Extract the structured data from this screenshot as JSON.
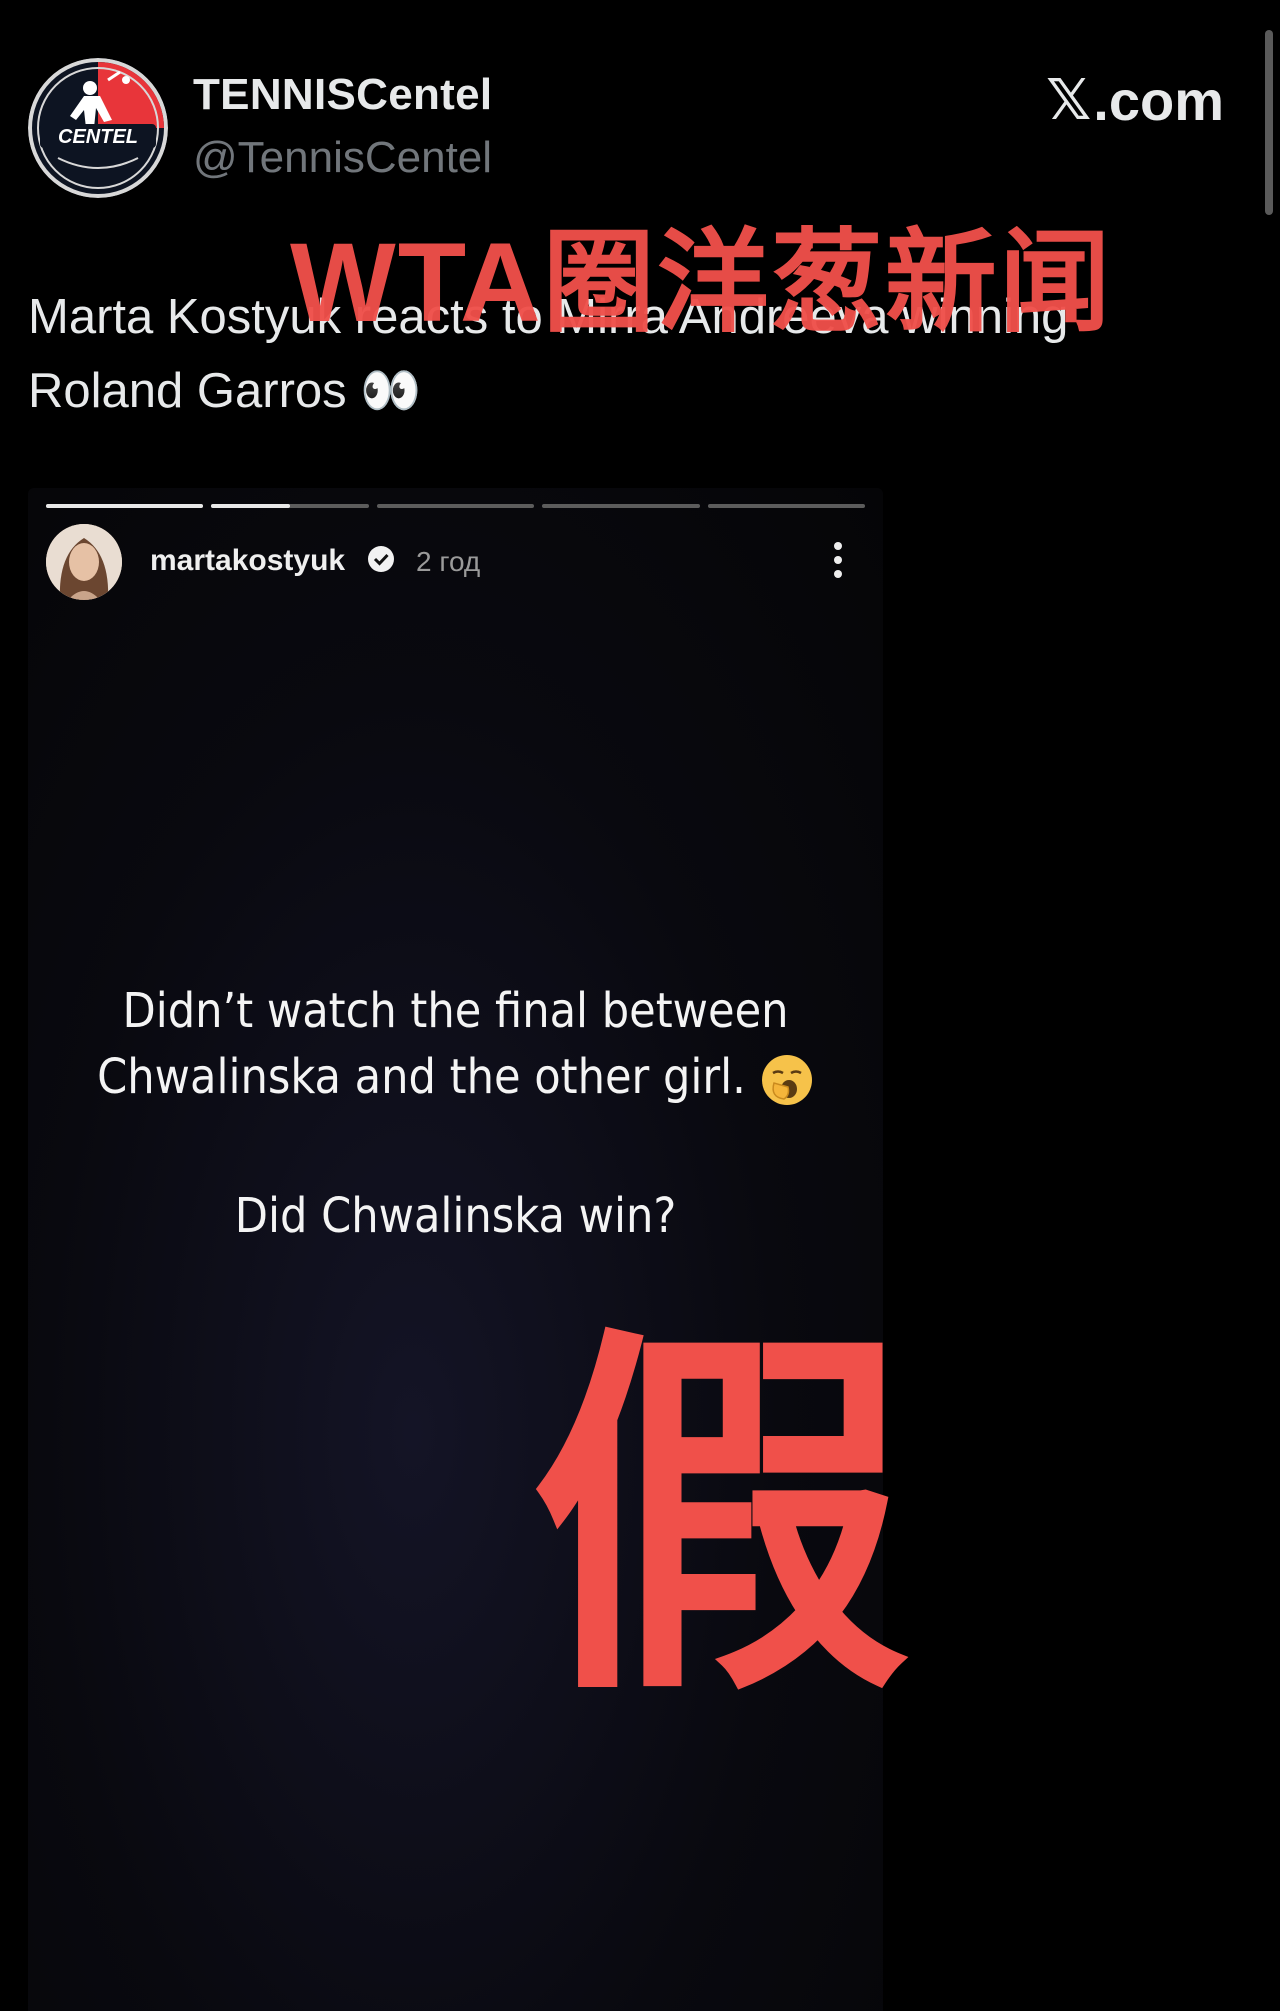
{
  "post": {
    "display_name": "TENNISCentel",
    "handle": "@TennisCentel",
    "source_logo": ".com",
    "avatar_text": "CENTEL",
    "text_line1": "Marta Kostyuk reacts to Mirra Andreeva winning",
    "text_line2": "Roland Garros",
    "text_emoji": "👀"
  },
  "overlay": {
    "title": "WTA圈洋葱新闻",
    "stamp": "假",
    "color": "#f0504a"
  },
  "story": {
    "username": "martakostyuk",
    "time": "2 год",
    "progress_segments": [
      1,
      0.5,
      0,
      0,
      0
    ],
    "line1": "Didn’t watch the final between",
    "line2": "Chwalinska and the other girl.",
    "line3": "Did Chwalinska win?"
  }
}
